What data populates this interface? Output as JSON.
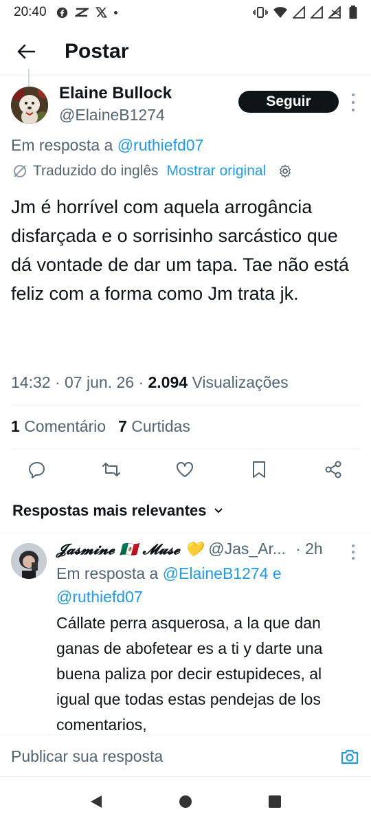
{
  "status_bar": {
    "time": "20:40",
    "left_icons": [
      "facebook-icon",
      "capcut-icon",
      "x-icon",
      "dot-icon"
    ],
    "right_icons": [
      "vibrate-icon",
      "wifi-icon",
      "signal-icon",
      "signal-icon",
      "no-signal-icon",
      "battery-icon"
    ]
  },
  "header": {
    "title": "Postar"
  },
  "tweet": {
    "author_name": "Elaine Bullock",
    "author_handle": "@ElaineB1274",
    "follow_label": "Seguir",
    "reply_prefix": "Em resposta a",
    "reply_mention": "@ruthiefd07",
    "translated_label": "Traduzido do inglês",
    "show_original_label": "Mostrar original",
    "body": "Jm é horrível com aquela arrogância disfarçada e o sorrisinho sarcástico que dá vontade de dar um tapa. Tae não está feliz com a forma como Jm trata jk.",
    "time": "14:32",
    "date": "07 jun. 26",
    "views_count": "2.094",
    "views_label": "Visualizações",
    "comments_count": "1",
    "comments_label": "Comentário",
    "likes_count": "7",
    "likes_label": "Curtidas"
  },
  "actions": [
    "reply-icon",
    "retweet-icon",
    "like-icon",
    "bookmark-icon",
    "share-icon"
  ],
  "replies_sort_label": "Respostas mais relevantes",
  "reply": {
    "name": "𝓙𝓪𝓼𝓶𝓲𝓷𝓮 🇲🇽 𝓜𝓾𝓼𝓮 💛",
    "handle": "@Jas_Ar...",
    "time": "· 2h",
    "reply_prefix": "Em resposta a",
    "reply_mention_1": "@ElaineB1274",
    "reply_joiner": "e",
    "reply_mention_2": "@ruthiefd07",
    "body": "Cállate perra asquerosa, a la que dan ganas de abofetear es a ti y darte una buena paliza por decir estupideces, al igual que todas estas pendejas de los comentarios,"
  },
  "composer": {
    "placeholder": "Publicar sua resposta"
  },
  "colors": {
    "accent": "#1d9bf0",
    "text": "#0f1419",
    "muted": "#536471",
    "divider": "#eff3f4"
  }
}
